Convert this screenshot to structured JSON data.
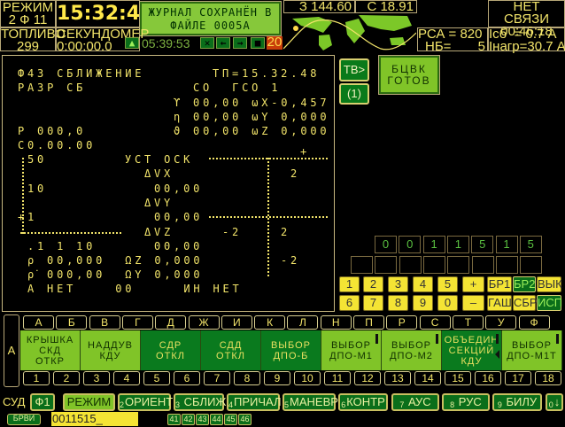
{
  "header": {
    "mode_label": "РЕЖИМ",
    "mode_value": "2 Ф 11",
    "clock": "15:32:48",
    "journal_line1": "ЖУРНАЛ СОХРАНЁН В",
    "journal_line2": "ФАЙЛЕ 0005А",
    "fuel_label": "ТОПЛИВО",
    "fuel_value": "299",
    "stopwatch_label": "СЕКУНДОМЕР",
    "stopwatch_value": "0:00:00.0",
    "sim_time": "05:39:53",
    "counter": "20",
    "longitude": "З 144.60",
    "latitude": "С 18.91",
    "link_status": "НЕТ СВЯЗИ",
    "link_timer": "00:46:18",
    "rsa": "РСА = 820",
    "nb_label": "НБ=",
    "nb_value": "5",
    "isb": "Iсб  = 0.7 А",
    "inagr": "Iнагр=30.7 А"
  },
  "display": {
    "lines": [
      "Ф43 СБЛИЖЕНИЕ",
      "ТП=15.32.48",
      "РАЗР СБ",
      "СО  ГСО 1",
      "ϒ 00,00 ωX-0,457",
      "η 00,00 ωY 0,000",
      "P 000,0",
      "ϑ 00,00 ωZ 0,000",
      "С0.00.00",
      "+",
      "50",
      "УСТ ОСК",
      "2",
      "ΔVX",
      "10",
      "00,00",
      "ΔVY",
      "+1",
      "00,00",
      "ΔVZ",
      "-2",
      "2",
      ".1 1 10",
      "00,00",
      "ρ 00,000  ΩZ 0,000",
      "-2",
      "ρ̇ 000,00  ΩY 0,000",
      "А НЕТ    00     ИН НЕТ"
    ]
  },
  "side": {
    "tv": "ТВ>",
    "one": "(1)",
    "bcvk1": "БЦВК",
    "bcvk2": "ГОТОВ"
  },
  "digits": {
    "row1": [
      "0",
      "0",
      "1",
      "1",
      "5",
      "1",
      "5"
    ]
  },
  "keypad": {
    "row1": [
      "1",
      "2",
      "3",
      "4",
      "5",
      "+",
      "БР1",
      "БР2",
      "ВЫК"
    ],
    "row2": [
      "6",
      "7",
      "8",
      "9",
      "0",
      "–",
      "ГАШ",
      "СБР",
      "ИСП"
    ]
  },
  "panel": {
    "side_label": "А",
    "letters": [
      "А",
      "Б",
      "В",
      "Г",
      "Д",
      "Ж",
      "И",
      "К",
      "Л",
      "Н",
      "П",
      "Р",
      "С",
      "Т",
      "У",
      "Ф"
    ],
    "cells": [
      [
        "КРЫШКА",
        "СКД",
        "ОТКР"
      ],
      [
        "НАДДУВ",
        "КДУ"
      ],
      [
        "СДР",
        "ОТКЛ"
      ],
      [
        "СДД",
        "ОТКЛ"
      ],
      [
        "ВЫБОР",
        "ДПО-Б"
      ],
      [
        "ВЫБОР",
        "ДПО-М1"
      ],
      [
        "ВЫБОР",
        "ДПО-М2"
      ],
      [
        "ОБЪЕДИН",
        "СЕКЦИЙ",
        "КДУ"
      ],
      [
        "ВЫБОР",
        "ДПО-М1Т"
      ]
    ],
    "numbers": [
      "1",
      "2",
      "3",
      "4",
      "5",
      "6",
      "7",
      "8",
      "9",
      "10",
      "11",
      "12",
      "13",
      "14",
      "15",
      "16",
      "17",
      "18"
    ]
  },
  "footer": {
    "sud": "СУД",
    "buttons": [
      {
        "n": "",
        "t": "Ф1"
      },
      {
        "n": "",
        "t": "РЕЖИМ"
      },
      {
        "n": "2",
        "t": "ОРИЕНТ"
      },
      {
        "n": "3",
        "t": " СБЛИЖ"
      },
      {
        "n": "4",
        "t": "ПРИЧАЛ"
      },
      {
        "n": "5",
        "t": "МАНЕВР"
      },
      {
        "n": "6",
        "t": "КОНТР"
      },
      {
        "n": "7",
        "t": " АУС"
      },
      {
        "n": "8",
        "t": " РУС"
      },
      {
        "n": "9",
        "t": " БИЛУ"
      },
      {
        "n": "0",
        "t": "↓"
      }
    ],
    "brvi": "БРВИ",
    "input": "0011515_",
    "small": [
      "41",
      "42",
      "43",
      "44",
      "45",
      "46"
    ]
  }
}
